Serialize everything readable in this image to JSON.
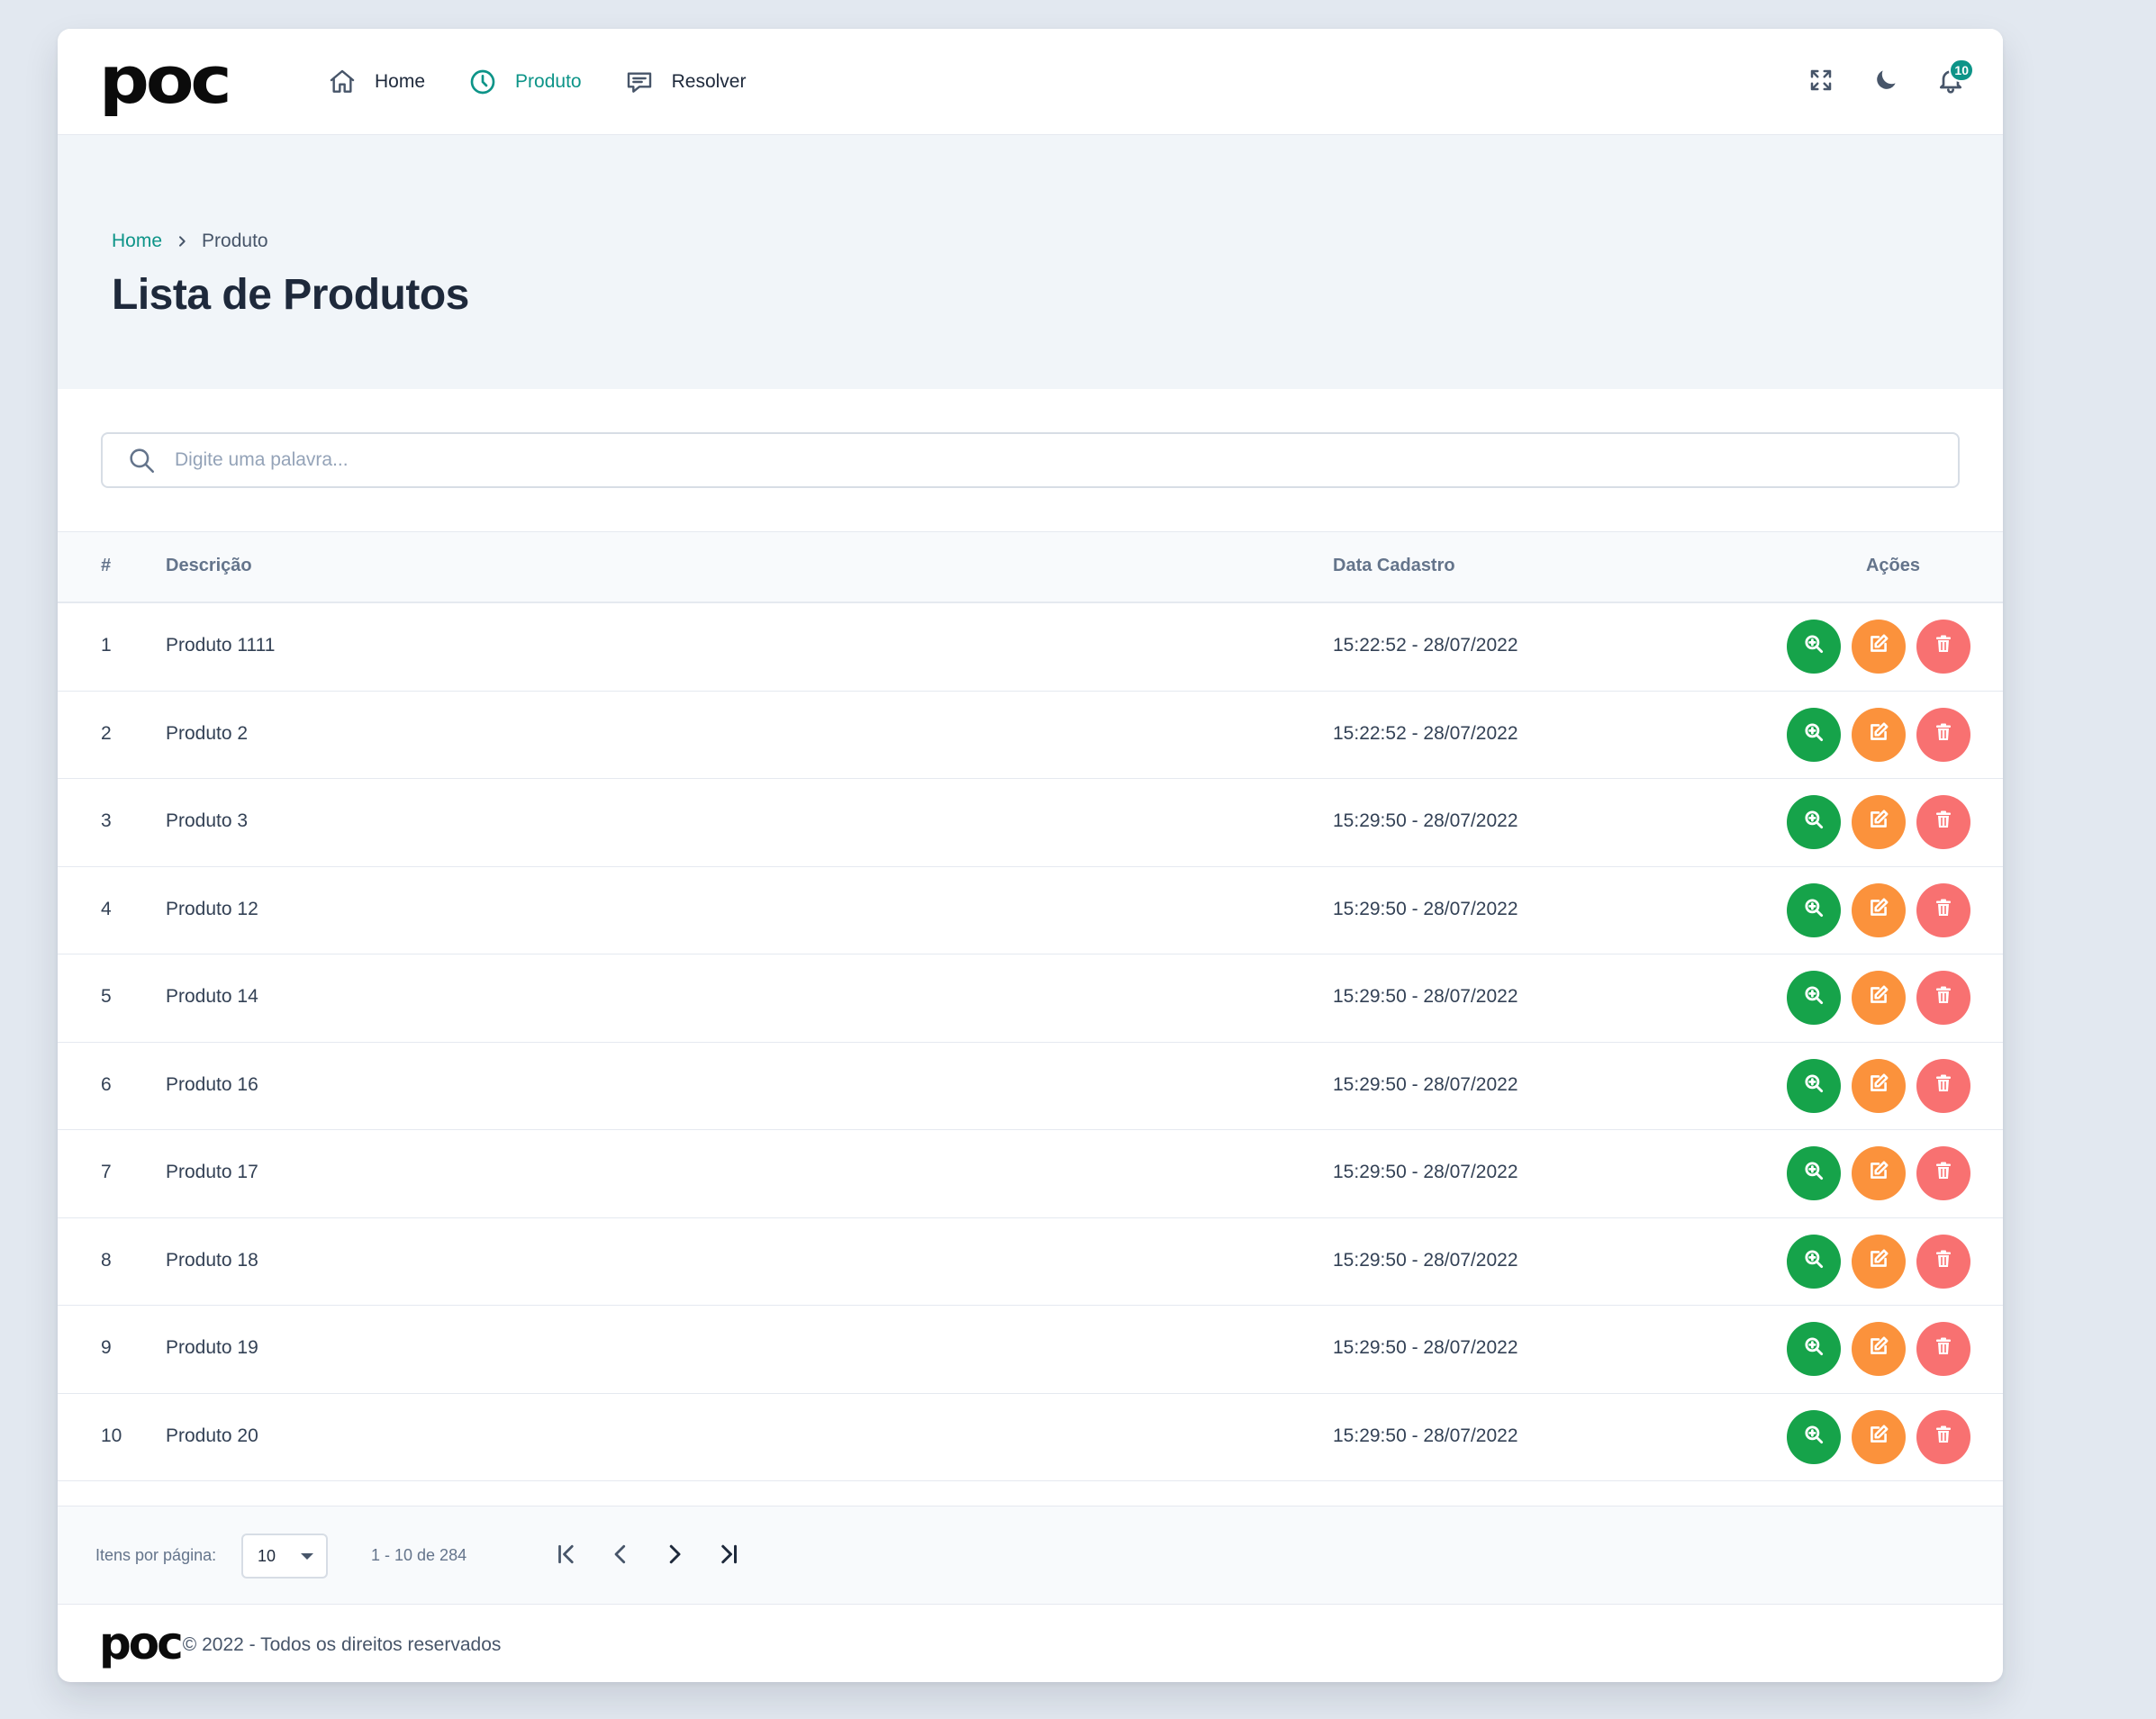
{
  "app": {
    "logo_text": "poc",
    "nav": [
      {
        "label": "Home",
        "icon": "home-icon"
      },
      {
        "label": "Produto",
        "icon": "clock-icon",
        "active": true
      },
      {
        "label": "Resolver",
        "icon": "message-icon"
      }
    ],
    "notifications_count": "10",
    "accent_color": "#0d9488"
  },
  "breadcrumb": {
    "home": "Home",
    "current": "Produto"
  },
  "page_title": "Lista de Produtos",
  "search": {
    "placeholder": "Digite uma palavra...",
    "value": ""
  },
  "table": {
    "headers": {
      "num": "#",
      "desc": "Descrição",
      "date": "Data Cadastro",
      "actions": "Ações"
    },
    "rows": [
      {
        "num": "1",
        "desc": "Produto 1111",
        "date": "15:22:52 - 28/07/2022"
      },
      {
        "num": "2",
        "desc": "Produto 2",
        "date": "15:22:52 - 28/07/2022"
      },
      {
        "num": "3",
        "desc": "Produto 3",
        "date": "15:29:50 - 28/07/2022"
      },
      {
        "num": "4",
        "desc": "Produto 12",
        "date": "15:29:50 - 28/07/2022"
      },
      {
        "num": "5",
        "desc": "Produto 14",
        "date": "15:29:50 - 28/07/2022"
      },
      {
        "num": "6",
        "desc": "Produto 16",
        "date": "15:29:50 - 28/07/2022"
      },
      {
        "num": "7",
        "desc": "Produto 17",
        "date": "15:29:50 - 28/07/2022"
      },
      {
        "num": "8",
        "desc": "Produto 18",
        "date": "15:29:50 - 28/07/2022"
      },
      {
        "num": "9",
        "desc": "Produto 19",
        "date": "15:29:50 - 28/07/2022"
      },
      {
        "num": "10",
        "desc": "Produto 20",
        "date": "15:29:50 - 28/07/2022"
      }
    ],
    "action_colors": {
      "view": "#16a34a",
      "edit": "#fb923c",
      "delete": "#f87171"
    }
  },
  "pagination": {
    "items_per_page_label": "Itens por página:",
    "items_per_page_value": "10",
    "range_text": "1 - 10 de 284"
  },
  "footer": {
    "logo_text": "poc",
    "copyright": "© 2022 - Todos os direitos reservados"
  }
}
